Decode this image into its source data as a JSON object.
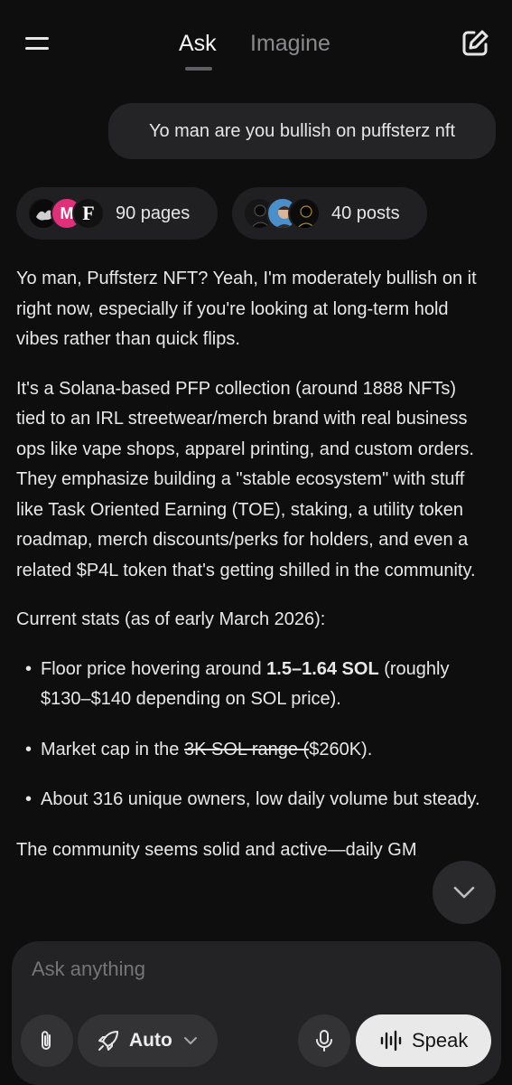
{
  "header": {
    "tabs": [
      {
        "label": "Ask",
        "active": true
      },
      {
        "label": "Imagine",
        "active": false
      }
    ]
  },
  "conversation": {
    "user_message": "Yo man are you bullish on puffsterz nft",
    "sources": {
      "pages_label": "90 pages",
      "posts_label": "40 posts",
      "page_avatars": [
        "dark-logo",
        "M",
        "F"
      ]
    },
    "response": {
      "p1": "Yo man, Puffsterz NFT? Yeah, I'm moderately bullish on it right now, especially if you're looking at long-term hold vibes rather than quick flips.",
      "p2": "It's a Solana-based PFP collection (around 1888 NFTs) tied to an IRL streetwear/merch brand with real business ops like vape shops, apparel printing, and custom orders. They emphasize building a \"stable ecosystem\" with stuff like Task Oriented Earning (TOE), staking, a utility token roadmap, merch discounts/perks for holders, and even a related $P4L token that's getting shilled in the community.",
      "p3": "Current stats (as of early March 2026):",
      "bullet1_pre": "Floor price hovering around ",
      "bullet1_bold": "1.5–1.64 SOL",
      "bullet1_post": " (roughly $130–$140 depending on SOL price).",
      "bullet2_pre": "Market cap in the ",
      "bullet2_strike": "3K SOL range (",
      "bullet2_post": "$260K).",
      "bullet3": "About 316 unique owners, low daily volume but steady.",
      "p4": "The community seems solid and active—daily GM"
    }
  },
  "composer": {
    "placeholder": "Ask anything",
    "mode_label": "Auto",
    "speak_label": "Speak"
  },
  "colors": {
    "background": "#0e0e0f",
    "bubble": "#242426",
    "speak_button": "#e9e9ea",
    "m_avatar": "#e0307a"
  },
  "icons": [
    "menu-icon",
    "compose-icon",
    "paperclip-icon",
    "rocket-icon",
    "chevron-down-icon",
    "microphone-icon",
    "waveform-icon"
  ]
}
